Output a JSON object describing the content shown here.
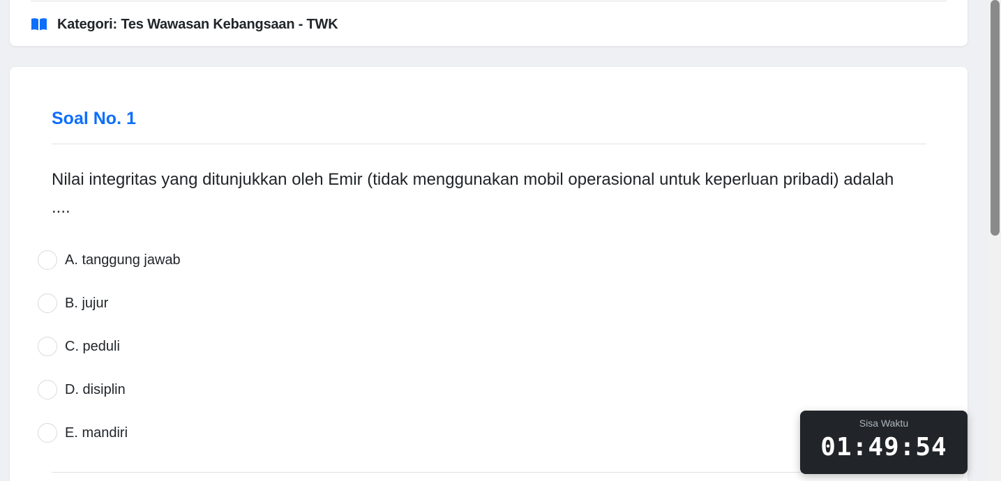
{
  "category": {
    "icon": "book-open-icon",
    "icon_color": "#0d6efd",
    "text": "Kategori: Tes Wawasan Kebangsaan - TWK"
  },
  "question": {
    "number_label": "Soal No. 1",
    "text": "Nilai integritas yang ditunjukkan oleh Emir (tidak menggunakan mobil operasional untuk keperluan pribadi) adalah ....",
    "options": [
      {
        "label": "A. tanggung jawab",
        "selected": false
      },
      {
        "label": "B. jujur",
        "selected": false
      },
      {
        "label": "C. peduli",
        "selected": false
      },
      {
        "label": "D. disiplin",
        "selected": false
      },
      {
        "label": "E. mandiri",
        "selected": false
      }
    ]
  },
  "timer": {
    "label": "Sisa Waktu",
    "value": "01:49:54"
  },
  "colors": {
    "accent": "#0d6efd",
    "timer_background": "#212529",
    "page_background": "#eef0f4"
  }
}
